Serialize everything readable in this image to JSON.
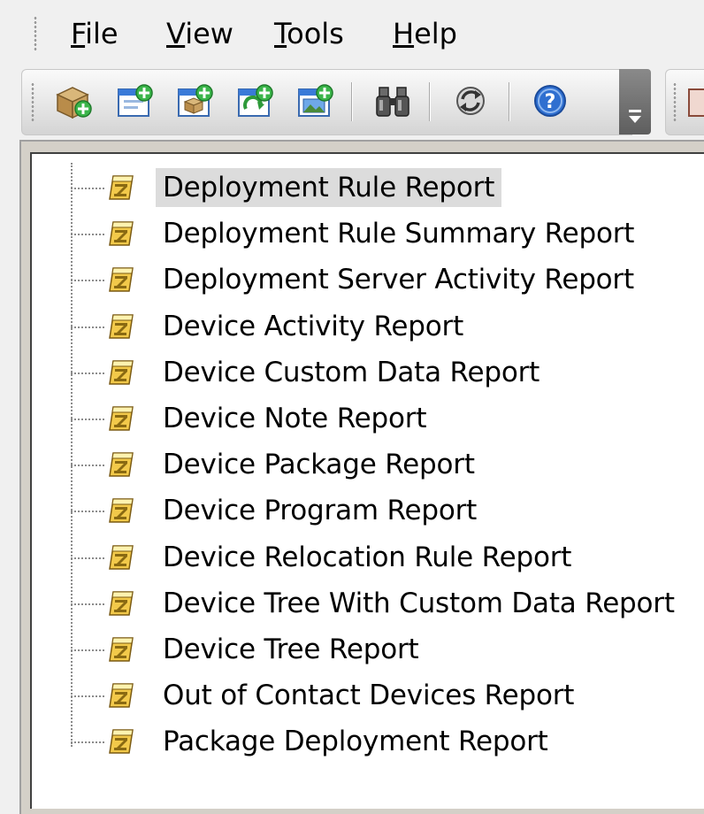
{
  "menu": [
    {
      "label": "File",
      "mnemonic": "F",
      "rest": "ile"
    },
    {
      "label": "View",
      "mnemonic": "V",
      "rest": "iew"
    },
    {
      "label": "Tools",
      "mnemonic": "T",
      "rest": "ools"
    },
    {
      "label": "Help",
      "mnemonic": "H",
      "rest": "elp"
    }
  ],
  "toolbar": {
    "buttons": [
      {
        "icon": "new-package-icon"
      },
      {
        "icon": "add-device-icon"
      },
      {
        "icon": "add-package-icon"
      },
      {
        "icon": "add-refresh-icon"
      },
      {
        "icon": "add-image-icon"
      },
      {
        "icon": "binoculars-icon"
      },
      {
        "icon": "refresh-icon"
      },
      {
        "icon": "help-icon"
      }
    ],
    "overflow_icon": "chevron-down-icon"
  },
  "tree": {
    "selected_index": 0,
    "item_icon": "report-icon",
    "items": [
      "Deployment Rule Report",
      "Deployment Rule Summary Report",
      "Deployment Server Activity Report",
      "Device Activity Report",
      "Device Custom Data Report",
      "Device Note Report",
      "Device Package Report",
      "Device Program Report",
      "Device Relocation Rule Report",
      "Device Tree With Custom Data Report",
      "Device Tree Report",
      "Out of Contact Devices Report",
      "Package Deployment Report"
    ]
  },
  "colors": {
    "selection": "#dcdcdc",
    "report_icon": "#d4a21a",
    "help_icon": "#2f6fd0",
    "add_badge": "#3bb54a"
  }
}
